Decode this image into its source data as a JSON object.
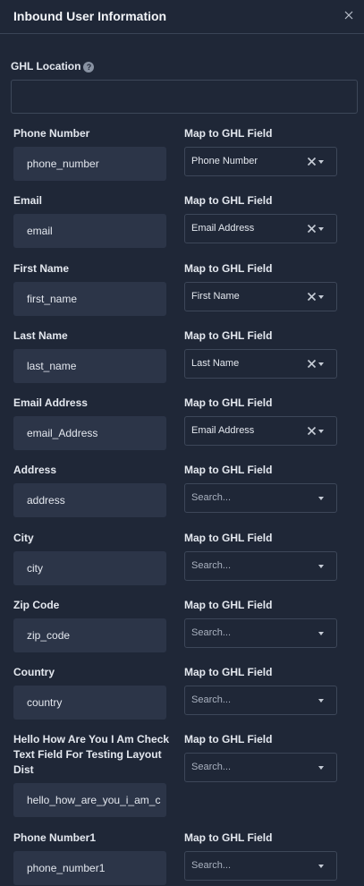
{
  "panel": {
    "title": "Inbound User Information"
  },
  "location": {
    "label": "GHL Location",
    "help": "?",
    "value": "",
    "placeholder": ""
  },
  "map_label": "Map to GHL Field",
  "rows": [
    {
      "label": "Phone Number",
      "value": "phone_number",
      "mapped": "Phone Number",
      "placeholder": ""
    },
    {
      "label": "Email",
      "value": "email",
      "mapped": "Email Address",
      "placeholder": ""
    },
    {
      "label": "First Name",
      "value": "first_name",
      "mapped": "First Name",
      "placeholder": ""
    },
    {
      "label": "Last Name",
      "value": "last_name",
      "mapped": "Last Name",
      "placeholder": ""
    },
    {
      "label": "Email Address",
      "value": "email_Address",
      "mapped": "Email Address",
      "placeholder": ""
    },
    {
      "label": "Address",
      "value": "address",
      "mapped": "",
      "placeholder": "Search..."
    },
    {
      "label": "City",
      "value": "city",
      "mapped": "",
      "placeholder": "Search..."
    },
    {
      "label": "Zip Code",
      "value": "zip_code",
      "mapped": "",
      "placeholder": "Search..."
    },
    {
      "label": "Country",
      "value": "country",
      "mapped": "",
      "placeholder": "Search..."
    },
    {
      "label": "Hello How Are You I Am Check Text Field For Testing Layout Dist",
      "value": "hello_how_are_you_i_am_c",
      "mapped": "",
      "placeholder": "Search..."
    },
    {
      "label": "Phone Number1",
      "value": "phone_number1",
      "mapped": "",
      "placeholder": "Search..."
    }
  ],
  "icons": {
    "close": "close-icon",
    "clear": "clear-icon",
    "caret": "chevron-down-icon",
    "help": "help-icon"
  },
  "colors": {
    "background": "#1f2737",
    "input_fill": "#2c3548",
    "border": "#3d4759",
    "text": "#e4e8ef",
    "placeholder": "#aab2c0"
  }
}
